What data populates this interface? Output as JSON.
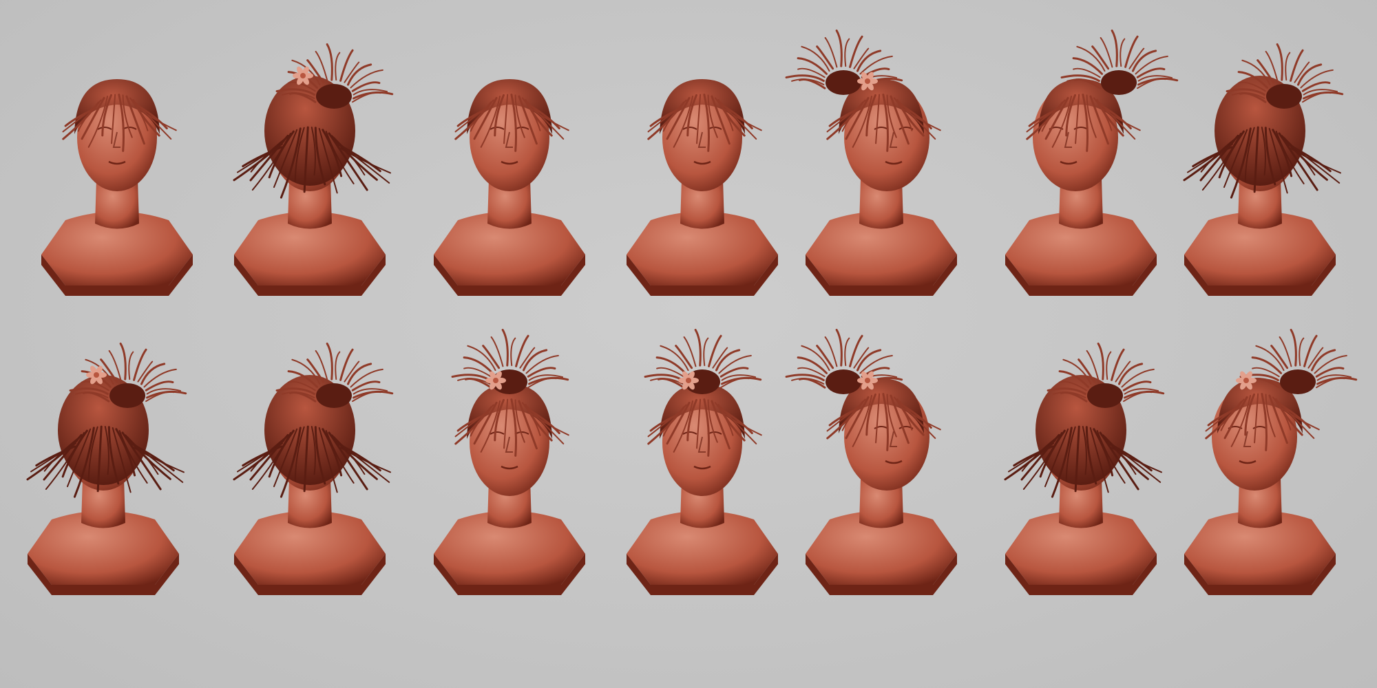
{
  "colors": {
    "background": "#c5c5c5",
    "clay_light": "#d98a73",
    "clay_mid": "#b8563f",
    "clay_dark": "#6e2416",
    "hair": "#8f3a28",
    "hair_dark": "#5a1d12",
    "flower": "#e3a08c"
  },
  "rows": [
    {
      "busts": [
        {
          "view": "front",
          "hair": "loose",
          "flower": false
        },
        {
          "view": "back-left",
          "hair": "ponytail",
          "flower": true
        },
        {
          "view": "front",
          "hair": "loose",
          "flower": false
        },
        {
          "view": "front",
          "hair": "loose",
          "flower": false
        },
        {
          "view": "right-profile",
          "hair": "ponytail",
          "flower": true
        },
        {
          "view": "left-three-quarter",
          "hair": "ponytail",
          "flower": false
        },
        {
          "view": "back-right",
          "hair": "ponytail",
          "flower": false
        }
      ]
    },
    {
      "busts": [
        {
          "view": "back-right",
          "hair": "ponytail",
          "flower": true
        },
        {
          "view": "back",
          "hair": "ponytail",
          "flower": false
        },
        {
          "view": "front-tilted-down",
          "hair": "ponytail",
          "flower": true
        },
        {
          "view": "front-tilted-down",
          "hair": "ponytail",
          "flower": true
        },
        {
          "view": "right-three-quarter",
          "hair": "ponytail",
          "flower": true
        },
        {
          "view": "back-left",
          "hair": "ponytail",
          "flower": false
        },
        {
          "view": "left-three-quarter",
          "hair": "ponytail",
          "flower": true
        }
      ]
    }
  ]
}
